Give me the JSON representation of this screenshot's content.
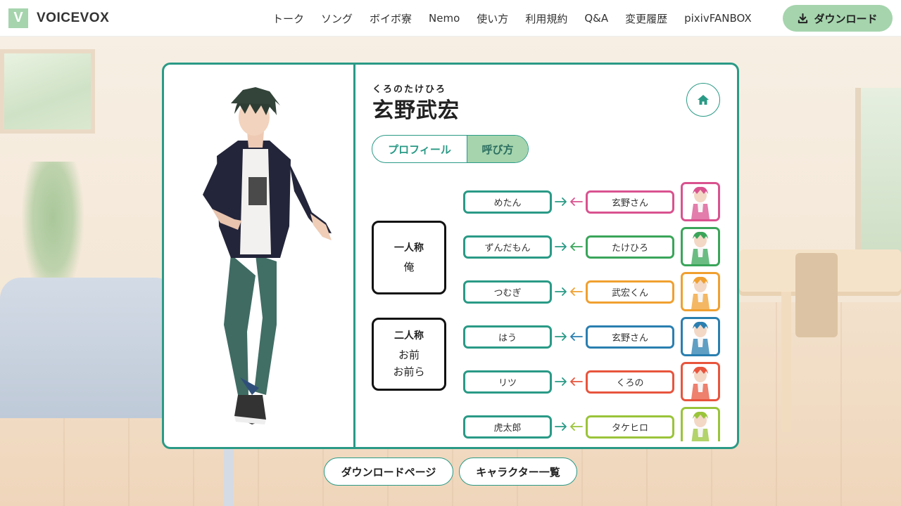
{
  "header": {
    "logo_letter": "V",
    "logo_text": "VOICEVOX",
    "nav": [
      "トーク",
      "ソング",
      "ボイボ寮",
      "Nemo",
      "使い方",
      "利用規約",
      "Q&A",
      "変更履歴",
      "pixivFANBOX"
    ],
    "download_label": "ダウンロード"
  },
  "character": {
    "ruby": "くろのたけひろ",
    "name": "玄野武宏"
  },
  "tabs": {
    "profile": "プロフィール",
    "calls": "呼び方",
    "active": "calls"
  },
  "pronouns": {
    "first_title": "一人称",
    "first_values": [
      "俺"
    ],
    "second_title": "二人称",
    "second_values": [
      "お前",
      "お前ら"
    ]
  },
  "call_rows": [
    {
      "left": "めたん",
      "right": "玄野さん",
      "color": "#d9528f"
    },
    {
      "left": "ずんだもん",
      "right": "たけひろ",
      "color": "#3aa55a"
    },
    {
      "left": "つむぎ",
      "right": "武宏くん",
      "color": "#f0a030"
    },
    {
      "left": "はう",
      "right": "玄野さん",
      "color": "#2a7fb0"
    },
    {
      "left": "リツ",
      "right": "くろの",
      "color": "#e8553d"
    },
    {
      "left": "虎太郎",
      "right": "タケヒロ",
      "color": "#9ac43a"
    }
  ],
  "bottom_buttons": {
    "download_page": "ダウンロードページ",
    "character_list": "キャラクター一覧"
  },
  "colors": {
    "accent": "#2a9a86",
    "accent_light": "#a5d4ad"
  }
}
